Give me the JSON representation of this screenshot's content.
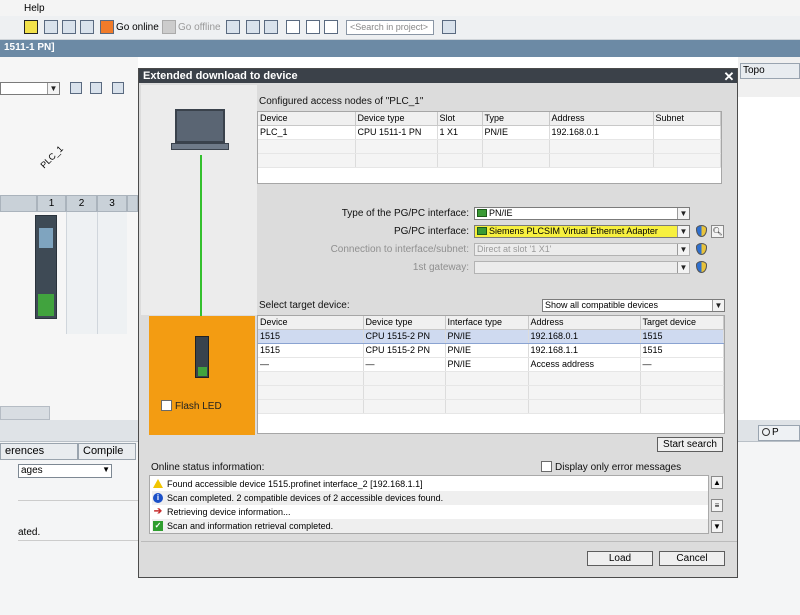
{
  "menubar": {
    "help": "Help"
  },
  "toolbar": {
    "go_online": "Go online",
    "go_offline": "Go offline",
    "search_placeholder": "<Search in project>"
  },
  "editor": {
    "title": "1511-1 PN]",
    "topology_tab": "Topo",
    "device_label": "PLC_1",
    "rack_slots": [
      "1",
      "2",
      "3"
    ],
    "right_pane_tab": "P"
  },
  "bottom_panel": {
    "tabs": [
      "erences",
      "Compile"
    ],
    "filter_value": "ages",
    "log_text": "ated."
  },
  "dialog": {
    "title": "Extended download to device",
    "configured_title": "Configured access nodes of \"PLC_1\"",
    "configured_table": {
      "headers": [
        "Device",
        "Device type",
        "Slot",
        "Type",
        "Address",
        "Subnet"
      ],
      "rows": [
        [
          "PLC_1",
          "CPU 1511-1 PN",
          "1 X1",
          "PN/IE",
          "192.168.0.1",
          ""
        ]
      ]
    },
    "interface_type_label": "Type of the PG/PC interface:",
    "interface_type_value": "PN/IE",
    "interface_label": "PG/PC interface:",
    "interface_value": "Siemens PLCSIM Virtual Ethernet Adapter",
    "connection_label": "Connection to interface/subnet:",
    "connection_value": "Direct at slot '1 X1'",
    "gateway_label": "1st gateway:",
    "gateway_value": "",
    "select_target_label": "Select target device:",
    "show_filter": "Show all compatible devices",
    "target_table": {
      "headers": [
        "Device",
        "Device type",
        "Interface type",
        "Address",
        "Target device"
      ],
      "rows": [
        [
          "1515",
          "CPU 1515-2 PN",
          "PN/IE",
          "192.168.0.1",
          "1515"
        ],
        [
          "1515",
          "CPU 1515-2 PN",
          "PN/IE",
          "192.168.1.1",
          "1515"
        ],
        [
          "—",
          "—",
          "PN/IE",
          "Access address",
          "—"
        ]
      ]
    },
    "flash_led": "Flash LED",
    "start_search": "Start search",
    "online_status_label": "Online status information:",
    "display_errors_label": "Display only error messages",
    "status_messages": [
      "Found accessible device 1515.profinet interface_2 [192.168.1.1]",
      "Scan completed. 2 compatible devices of 2 accessible devices found.",
      "Retrieving device information...",
      "Scan and information retrieval completed."
    ],
    "load_button": "Load",
    "cancel_button": "Cancel"
  }
}
